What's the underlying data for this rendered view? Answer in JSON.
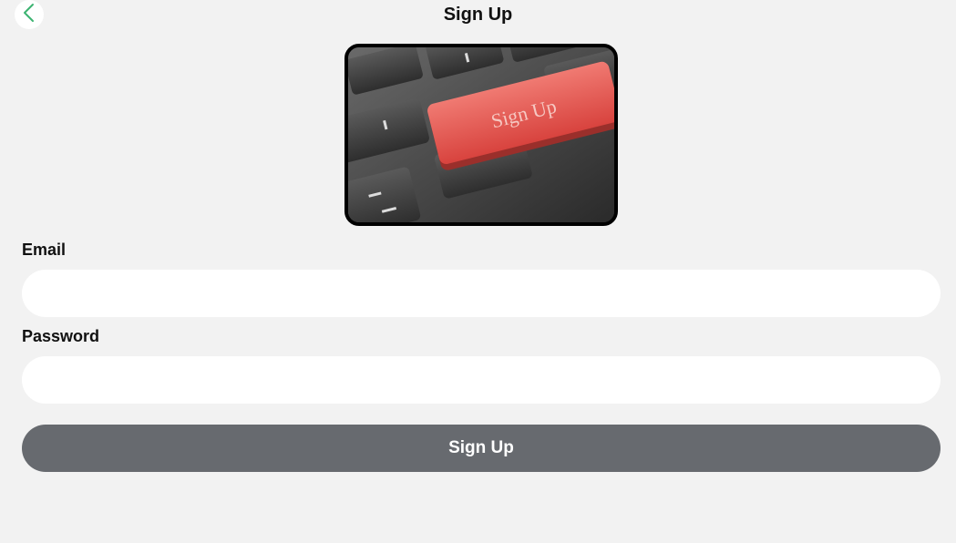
{
  "header": {
    "title": "Sign Up",
    "back_icon": "chevron-left-icon"
  },
  "hero": {
    "key_label": "Sign Up",
    "colors": {
      "key": "#e8504b",
      "keyboard": "#3a3a3a"
    }
  },
  "form": {
    "email_label": "Email",
    "email_value": "",
    "password_label": "Password",
    "password_value": "",
    "submit_label": "Sign Up"
  },
  "colors": {
    "background": "#f2f2f2",
    "accent": "#3cb371",
    "button": "#676a6f"
  }
}
